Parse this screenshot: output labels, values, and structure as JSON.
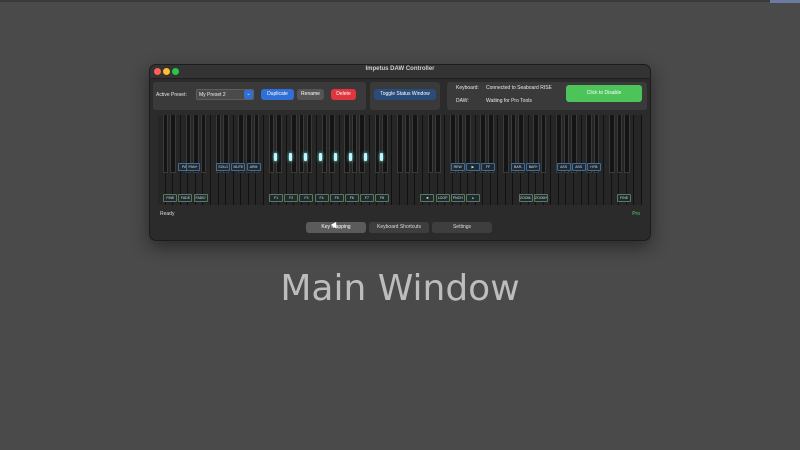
{
  "window": {
    "title": "Impetus DAW Controller"
  },
  "preset": {
    "label": "Active Preset:",
    "value": "My Preset 2",
    "duplicate": "Duplicate",
    "rename": "Rename",
    "delete": "Delete"
  },
  "status_window": {
    "toggle": "Toggle Status Window"
  },
  "connection": {
    "keyboard_label": "Keyboard:",
    "keyboard_value": "Connected to Seaboard RISE",
    "daw_label": "DAW:",
    "daw_value": "Waiting for Pro Tools",
    "disable_button": "Click to Disable"
  },
  "keyboard": {
    "white_key_count": 64,
    "upper_labels": [
      {
        "key": 3,
        "text": "PAN"
      },
      {
        "key": 4,
        "text": "PAN+"
      },
      {
        "key": 8,
        "text": "SOLO"
      },
      {
        "key": 10,
        "text": "MUTE"
      },
      {
        "key": 12,
        "text": "ARM"
      },
      {
        "key": 39,
        "text": "REW"
      },
      {
        "key": 41,
        "text": "▶"
      },
      {
        "key": 43,
        "text": "FF"
      },
      {
        "key": 47,
        "text": "BAR-"
      },
      {
        "key": 49,
        "text": "BAR+"
      },
      {
        "key": 53,
        "text": "ASS"
      },
      {
        "key": 55,
        "text": "ASS"
      },
      {
        "key": 57,
        "text": "HYB"
      }
    ],
    "lower_labels": [
      {
        "key": 1,
        "text": "FINE"
      },
      {
        "key": 3,
        "text": "FADE"
      },
      {
        "key": 5,
        "text": "FADE/"
      },
      {
        "key": 15,
        "text": "F1"
      },
      {
        "key": 17,
        "text": "F2"
      },
      {
        "key": 19,
        "text": "F3"
      },
      {
        "key": 21,
        "text": "F4"
      },
      {
        "key": 23,
        "text": "F5"
      },
      {
        "key": 25,
        "text": "F6"
      },
      {
        "key": 27,
        "text": "F7"
      },
      {
        "key": 29,
        "text": "F8"
      },
      {
        "key": 35,
        "text": "■"
      },
      {
        "key": 37,
        "text": "LOOP"
      },
      {
        "key": 39,
        "text": "PNCH"
      },
      {
        "key": 41,
        "text": "●"
      },
      {
        "key": 48,
        "text": "ZOOM-"
      },
      {
        "key": 50,
        "text": "ZOOM+"
      },
      {
        "key": 61,
        "text": "FINE"
      }
    ]
  },
  "status": {
    "left": "Ready",
    "right": "Pro"
  },
  "tabs": [
    "Key Mapping",
    "Keyboard Shortcuts",
    "Settings"
  ],
  "caption": "Main Window",
  "colors": {
    "accent_blue": "#2f6fd6",
    "delete_red": "#e0353f",
    "disable_green": "#4cc45a",
    "glow_cyan": "#bff6ff"
  }
}
